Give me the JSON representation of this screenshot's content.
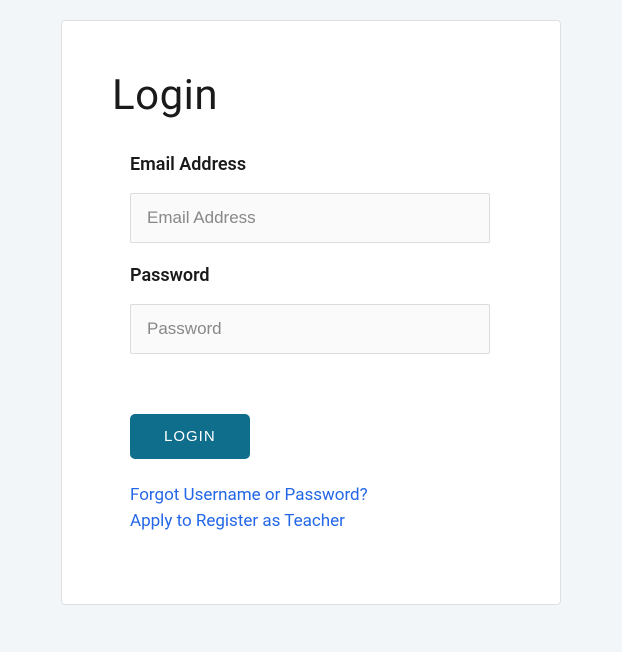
{
  "page": {
    "title": "Login"
  },
  "form": {
    "email": {
      "label": "Email Address",
      "placeholder": "Email Address",
      "value": ""
    },
    "password": {
      "label": "Password",
      "placeholder": "Password",
      "value": ""
    },
    "submit_label": "LOGIN"
  },
  "links": {
    "forgot": "Forgot Username or Password?",
    "register_teacher": "Apply to Register as Teacher"
  }
}
